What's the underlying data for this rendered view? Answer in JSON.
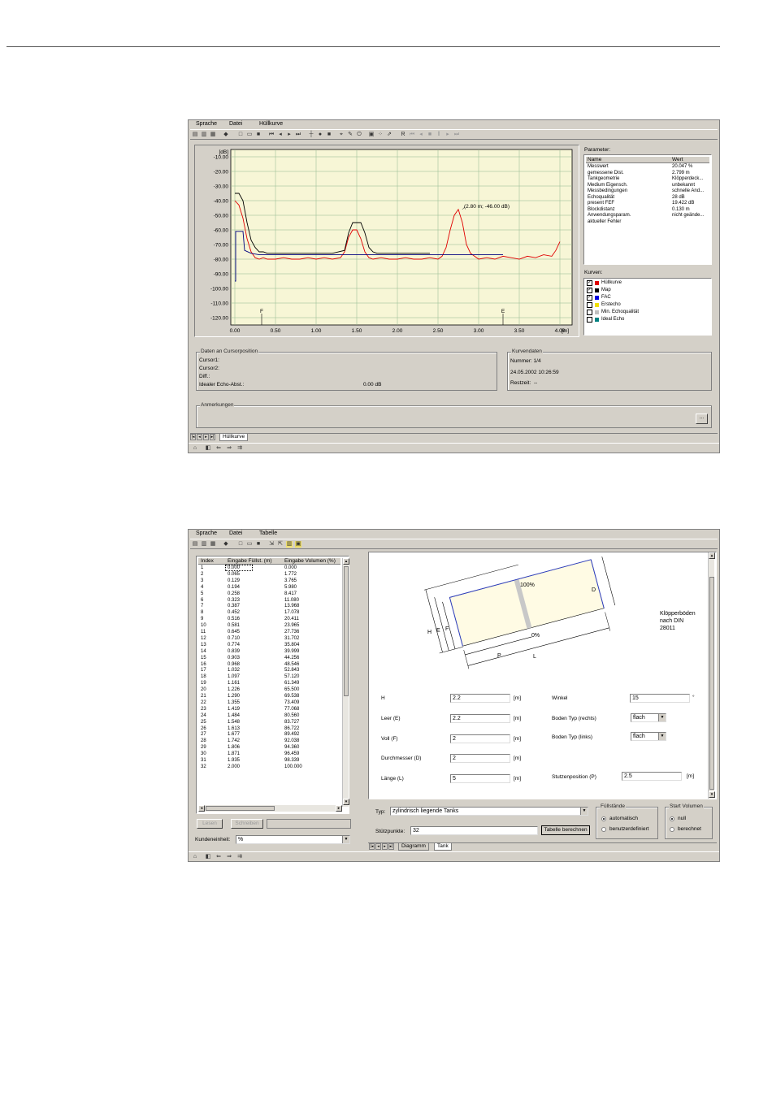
{
  "window1": {
    "menu": [
      "Sprache",
      "Datei",
      "Hüllkurve"
    ],
    "chart_data": {
      "type": "line",
      "ylabel": "[dB]",
      "xlabel": "[m]",
      "yticks": [
        "-10.00",
        "-20.00",
        "-30.00",
        "-40.00",
        "-50.00",
        "-60.00",
        "-70.00",
        "-80.00",
        "-90.00",
        "-100.00",
        "-110.00",
        "-120.00"
      ],
      "xticks": [
        "0.00",
        "0.50",
        "1.00",
        "1.50",
        "2.00",
        "2.50",
        "3.00",
        "3.50",
        "4.00"
      ],
      "ylim": [
        -125,
        -5
      ],
      "xlim": [
        -0.05,
        4.15
      ],
      "annotation": "(2.80 m; -46.00 dB)",
      "annotation_point": [
        2.8,
        -46
      ],
      "markers": [
        {
          "label": "F",
          "x": 0.33
        },
        {
          "label": "E",
          "x": 3.3
        }
      ],
      "series": [
        {
          "name": "Hüllkurve",
          "color": "#000000",
          "x": [
            0.0,
            0.05,
            0.1,
            0.15,
            0.2,
            0.25,
            0.3,
            0.35,
            0.4,
            0.6,
            0.8,
            1.0,
            1.2,
            1.35,
            1.4,
            1.45,
            1.55,
            1.6,
            1.65,
            1.7,
            1.75,
            1.8,
            2.0,
            2.2,
            2.4
          ],
          "y": [
            -35,
            -35,
            -40,
            -55,
            -67,
            -72,
            -75,
            -75,
            -76,
            -76,
            -76,
            -76,
            -76,
            -74,
            -62,
            -55,
            -55,
            -62,
            -72,
            -75,
            -76,
            -76,
            -76,
            -76,
            -76
          ]
        },
        {
          "name": "Map",
          "color": "#000080",
          "x": [
            0.0,
            0.01,
            0.01,
            0.1,
            0.12,
            0.2,
            0.3,
            0.5,
            1.0,
            1.5,
            2.0,
            2.5,
            3.0,
            3.3
          ],
          "y": [
            -95,
            -95,
            -61,
            -61,
            -74,
            -76,
            -77,
            -77,
            -77,
            -77,
            -77,
            -77,
            -77,
            -77
          ]
        },
        {
          "name": "FAC",
          "color": "#e00000",
          "x": [
            0.0,
            0.05,
            0.1,
            0.15,
            0.2,
            0.25,
            0.3,
            0.35,
            0.4,
            0.5,
            0.6,
            0.7,
            0.8,
            0.9,
            1.0,
            1.1,
            1.2,
            1.3,
            1.35,
            1.4,
            1.45,
            1.5,
            1.55,
            1.6,
            1.65,
            1.7,
            1.8,
            1.9,
            2.0,
            2.1,
            2.2,
            2.3,
            2.4,
            2.5,
            2.55,
            2.6,
            2.65,
            2.7,
            2.75,
            2.8,
            2.85,
            2.9,
            2.95,
            3.0,
            3.1,
            3.2,
            3.3,
            3.4,
            3.5,
            3.6,
            3.7,
            3.8,
            3.9,
            3.95,
            4.0
          ],
          "y": [
            -40,
            -43,
            -52,
            -66,
            -75,
            -79,
            -80,
            -79,
            -80,
            -80,
            -79,
            -80,
            -80,
            -79,
            -80,
            -79,
            -80,
            -79,
            -75,
            -65,
            -60,
            -60,
            -66,
            -75,
            -79,
            -80,
            -79,
            -80,
            -80,
            -79,
            -80,
            -80,
            -79,
            -80,
            -78,
            -72,
            -60,
            -50,
            -46,
            -55,
            -70,
            -76,
            -78,
            -80,
            -79,
            -80,
            -78,
            -79,
            -80,
            -78,
            -79,
            -77,
            -78,
            -74,
            -68
          ]
        }
      ]
    },
    "params": {
      "caption": "Parameter:",
      "col_name": "Name",
      "col_value": "Wert",
      "rows": [
        {
          "name": "Messwert",
          "value": "20.047  %"
        },
        {
          "name": "gemessene Dist.",
          "value": "2.799  m"
        },
        {
          "name": "Tankgeometrie",
          "value": "Klöpperdeck..."
        },
        {
          "name": "Medium Eigensch.",
          "value": "unbekannt"
        },
        {
          "name": "Messbedingungen",
          "value": "schnelle And..."
        },
        {
          "name": "Echoqualität",
          "value": "28  dB"
        },
        {
          "name": "present FEF",
          "value": "19.422  dB"
        },
        {
          "name": "Blockdistanz",
          "value": "0.130  m"
        },
        {
          "name": "Anwendungsparam.",
          "value": "nicht geände..."
        },
        {
          "name": "aktueller Fehler",
          "value": ""
        }
      ]
    },
    "curves": {
      "caption": "Kurven:",
      "items": [
        {
          "label": "Hüllkurve",
          "checked": "✓",
          "color": "#e00000"
        },
        {
          "label": "Map",
          "checked": "✓",
          "color": "#000000"
        },
        {
          "label": "FAC",
          "checked": "✓",
          "color": "#0000e0"
        },
        {
          "label": "Erstecho",
          "checked": "",
          "color": "#f0e000"
        },
        {
          "label": "Min. Echoqualität",
          "checked": "",
          "color": "#c0c0c0"
        },
        {
          "label": "Ideal Echo",
          "checked": "",
          "color": "#008080"
        }
      ]
    },
    "cursor": {
      "caption": "Daten an Cursorposition",
      "cursor1": "Cursor1:",
      "cursor2": "Cursor2:",
      "diff": "Diff.:",
      "ideal_label": "Idealer Echo-Abst.:",
      "ideal_value": "0.00 dB"
    },
    "curvedata": {
      "caption": "Kurvendaten",
      "number": "Nummer:  1/4",
      "datetime": "24.05.2002  10:26:59",
      "rest_label": "Restzeit:",
      "rest_value": "--"
    },
    "notes": {
      "caption": "Anmerkungen",
      "button": "..."
    },
    "tab": "Hüllkurve"
  },
  "window2": {
    "menu": [
      "Sprache",
      "Datei",
      "Tabelle"
    ],
    "table": {
      "headers": [
        "Index",
        "Eingabe Füllst. (m)",
        "Eingabe Volumen (%)"
      ],
      "rows": [
        [
          "1",
          "0.000",
          "0.000"
        ],
        [
          "2",
          "0.065",
          "1.772"
        ],
        [
          "3",
          "0.129",
          "3.765"
        ],
        [
          "4",
          "0.194",
          "5.980"
        ],
        [
          "5",
          "0.258",
          "8.417"
        ],
        [
          "6",
          "0.323",
          "11.080"
        ],
        [
          "7",
          "0.387",
          "13.968"
        ],
        [
          "8",
          "0.452",
          "17.078"
        ],
        [
          "9",
          "0.516",
          "20.411"
        ],
        [
          "10",
          "0.581",
          "23.965"
        ],
        [
          "11",
          "0.645",
          "27.736"
        ],
        [
          "12",
          "0.710",
          "31.702"
        ],
        [
          "13",
          "0.774",
          "35.804"
        ],
        [
          "14",
          "0.839",
          "39.999"
        ],
        [
          "15",
          "0.903",
          "44.256"
        ],
        [
          "16",
          "0.968",
          "48.546"
        ],
        [
          "17",
          "1.032",
          "52.843"
        ],
        [
          "18",
          "1.097",
          "57.120"
        ],
        [
          "19",
          "1.161",
          "61.349"
        ],
        [
          "20",
          "1.226",
          "65.500"
        ],
        [
          "21",
          "1.290",
          "69.538"
        ],
        [
          "22",
          "1.355",
          "73.409"
        ],
        [
          "23",
          "1.419",
          "77.068"
        ],
        [
          "24",
          "1.484",
          "80.560"
        ],
        [
          "25",
          "1.548",
          "83.727"
        ],
        [
          "26",
          "1.613",
          "86.722"
        ],
        [
          "27",
          "1.677",
          "89.492"
        ],
        [
          "28",
          "1.742",
          "92.038"
        ],
        [
          "29",
          "1.806",
          "94.360"
        ],
        [
          "30",
          "1.871",
          "96.459"
        ],
        [
          "31",
          "1.935",
          "98.339"
        ],
        [
          "32",
          "2.000",
          "100.000"
        ]
      ]
    },
    "read_btn": "Lesen",
    "write_btn": "Schreiben",
    "unit_label": "Kundeneinheit:",
    "unit_value": "%",
    "diagram": {
      "pct100": "100%",
      "pct0": "0%",
      "lbl_D": "D",
      "lbl_H": "H",
      "lbl_E": "E",
      "lbl_F": "F",
      "lbl_P": "P",
      "lbl_L": "L",
      "note_l1": "Klöpperböden",
      "note_l2": "nach DIN",
      "note_l3": "28011"
    },
    "form": {
      "h_label": "H",
      "h_value": "2.2",
      "h_unit": "[m]",
      "leer_label": "Leer (E)",
      "leer_value": "2.2",
      "leer_unit": "[m]",
      "voll_label": "Voll (F)",
      "voll_value": "2",
      "voll_unit": "[m]",
      "d_label": "Durchmesser (D)",
      "d_value": "2",
      "d_unit": "[m]",
      "l_label": "Länge (L)",
      "l_value": "5",
      "l_unit": "[m]",
      "winkel_label": "Winkel",
      "winkel_value": "15",
      "winkel_unit": "°",
      "boden_r_label": "Boden Typ (rechts)",
      "boden_r_value": "flach",
      "boden_l_label": "Boden Typ (links)",
      "boden_l_value": "flach",
      "stutzen_label": "Stutzenposition (P)",
      "stutzen_value": "2.5",
      "stutzen_unit": "[m]"
    },
    "typ_label": "Typ:",
    "typ_value": "zylindrisch liegende Tanks",
    "stuetz_label": "Stützpunkte:",
    "stuetz_value": "32",
    "calc_btn": "Tabelle berechnen",
    "fill_group": {
      "caption": "Füllstände",
      "opt1": "automatisch",
      "opt2": "benutzerdefiniert"
    },
    "start_group": {
      "caption": "Start Volumen",
      "opt1": "null",
      "opt2": "berechnet"
    },
    "tabs": [
      "Diagramm",
      "Tank"
    ]
  }
}
